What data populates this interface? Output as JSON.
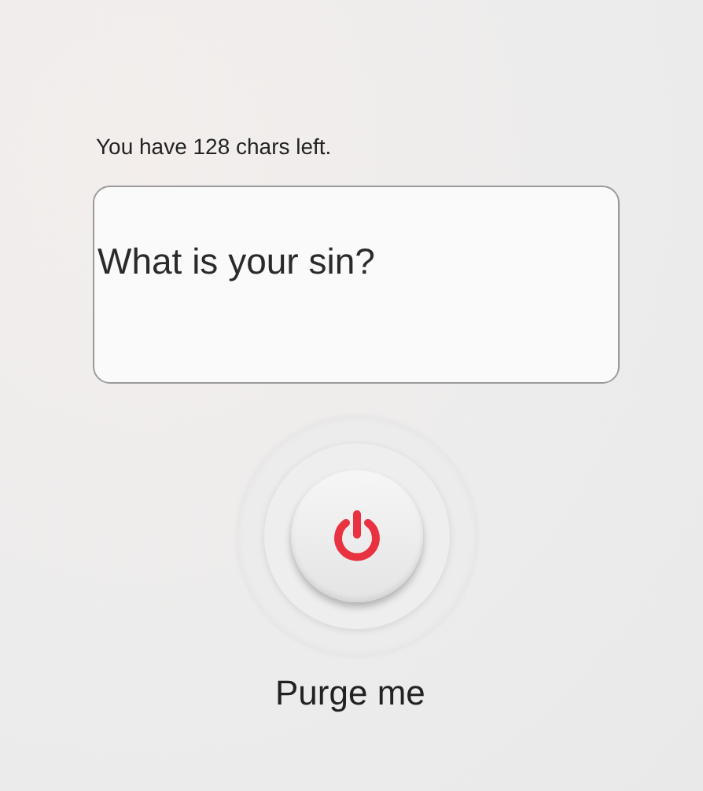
{
  "counter": "You have 128 chars left.",
  "sin_field": {
    "placeholder": "What is your sin?"
  },
  "power_button": {
    "label": "Purge me"
  }
}
